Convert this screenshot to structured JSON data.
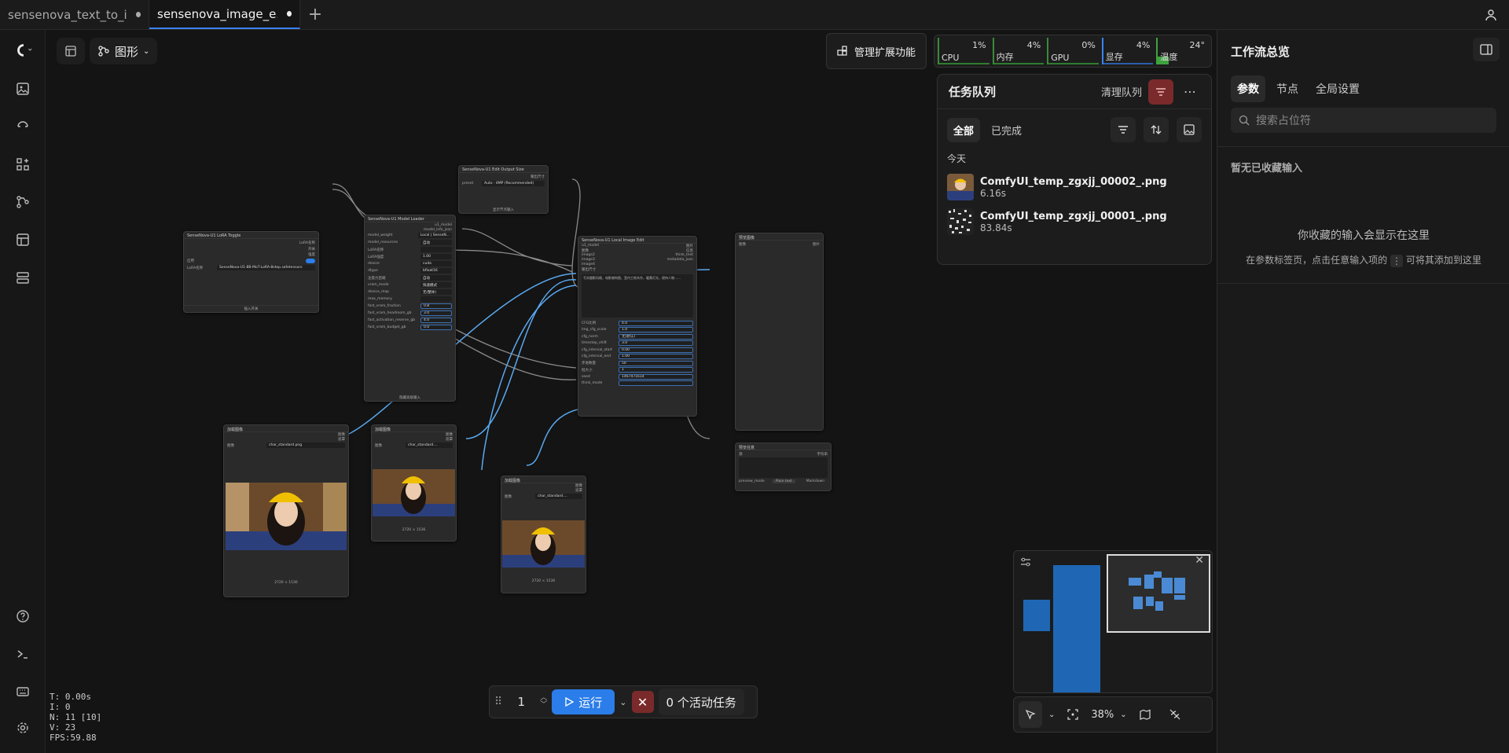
{
  "tabs": [
    {
      "label": "sensenova_text_to_i...",
      "active": false
    },
    {
      "label": "sensenova_image_e...",
      "active": true
    }
  ],
  "toolbar": {
    "graph_label": "图形",
    "manage_extensions": "管理扩展功能"
  },
  "stats": [
    {
      "label": "CPU",
      "value": "1%",
      "fraction": 0.01
    },
    {
      "label": "内存",
      "value": "4%",
      "fraction": 0.04
    },
    {
      "label": "GPU",
      "value": "0%",
      "fraction": 0.0
    },
    {
      "label": "显存",
      "value": "4%",
      "fraction": 0.04
    },
    {
      "label": "温度",
      "value": "24°",
      "fraction": 0.24
    }
  ],
  "queue": {
    "title": "任务队列",
    "clear_label": "清理队列",
    "filter_all": "全部",
    "filter_done": "已完成",
    "section_today": "今天",
    "items": [
      {
        "name": "ComfyUI_temp_zgxjj_00002_.png",
        "time": "6.16s"
      },
      {
        "name": "ComfyUI_temp_zgxjj_00001_.png",
        "time": "83.84s"
      }
    ]
  },
  "run": {
    "count": "1",
    "run_label": "运行",
    "active_tasks": "0 个活动任务"
  },
  "zoom": "38%",
  "fps": {
    "t": "T: 0.00s",
    "i": "I: 0",
    "n": "N: 11 [10]",
    "v": "V: 23",
    "fps": "FPS:59.88"
  },
  "right_panel": {
    "title": "工作流总览",
    "tabs": [
      "参数",
      "节点",
      "全局设置"
    ],
    "search_placeholder": "搜索占位符",
    "no_favorites": "暂无已收藏输入",
    "empty_title": "你收藏的输入会显示在这里",
    "empty_sub_a": "在参数标签页，点击任意输入项的",
    "empty_sub_b": "可将其添加到这里"
  },
  "nodes": {
    "lora_toggle": {
      "title": "SenseNova-U1 LoRA Toggle",
      "outputs": [
        "LoRA名称",
        "开关",
        "强度"
      ],
      "enable_label": "启用",
      "lora_label": "LoRA名称",
      "lora_value": "SenseNova-U1-8B-MoT-LoRA-8step.safetensors",
      "footer": "插入开关"
    },
    "output_size": {
      "title": "SenseNova-U1 Edit Output Size",
      "out": "输出尺寸",
      "preset_label": "preset",
      "preset_value": "Auto - 4MP (Recommended)",
      "footer": "显示节点输入"
    },
    "model_loader": {
      "title": "SenseNova-U1 Model Loader",
      "outputs": [
        "u1_model",
        "model_info_json"
      ],
      "rows": [
        {
          "label": "model_weight",
          "value": "Local | SenseN..."
        },
        {
          "label": "model_resources",
          "value": "自动"
        },
        {
          "label": "LoRA名称",
          "value": ""
        },
        {
          "label": "LoRA强度",
          "value": "1.00"
        },
        {
          "label": "device",
          "value": "cuda"
        },
        {
          "label": "dtype",
          "value": "bfloat16"
        },
        {
          "label": "注意力后端",
          "value": "自动"
        },
        {
          "label": "vram_mode",
          "value": "快速模式"
        },
        {
          "label": "device_map",
          "value": "无(整体)"
        },
        {
          "label": "max_memory",
          "value": ""
        },
        {
          "label": "fast_vram_fraction",
          "value": "0.8"
        },
        {
          "label": "fast_vram_headroom_gb",
          "value": "3.0"
        },
        {
          "label": "fast_activation_reserve_gb",
          "value": "4.0"
        },
        {
          "label": "fast_vram_budget_gb",
          "value": "0.0"
        }
      ],
      "footer": "隐藏高级输入"
    },
    "image_edit": {
      "title": "SenseNova-U1 Local Image Edit",
      "inputs": [
        "u1_model",
        "图像",
        "image2",
        "image3",
        "image4",
        "输出尺寸"
      ],
      "outputs": [
        "图片",
        "信息",
        "think_text",
        "metadata_json"
      ],
      "prompt": "写实摄影风格，电影感构图，室内工地木作，暖黄灯光，保持人物……",
      "rows": [
        {
          "label": "CFG比例",
          "value": "4.0"
        },
        {
          "label": "img_cfg_scale",
          "value": "1.0"
        },
        {
          "label": "cfg_norm",
          "value": "无(默认)"
        },
        {
          "label": "timestep_shift",
          "value": "3.0"
        },
        {
          "label": "cfg_interval_start",
          "value": "0.00"
        },
        {
          "label": "cfg_interval_end",
          "value": "1.00"
        },
        {
          "label": "步进数量",
          "value": "50"
        },
        {
          "label": "批大小",
          "value": "1"
        },
        {
          "label": "seed",
          "value": "1467471614"
        },
        {
          "label": "think_mode",
          "value": ""
        }
      ]
    },
    "preview": {
      "title": "预览图像",
      "in": "图像",
      "out": "图片"
    },
    "preview_text": {
      "title": "预览任意",
      "in": "源",
      "out": "字符串",
      "mode_label": "preview_mode",
      "plain": "Plain text",
      "markdown": "Markdown"
    },
    "load1": {
      "title": "加载图像",
      "file": "char_standard.png",
      "outputs": [
        "图像",
        "遮罩"
      ],
      "size": "2720 × 1536"
    },
    "load2": {
      "title": "加载图像",
      "file": "char_standard....",
      "outputs": [
        "图像",
        "遮罩"
      ],
      "size": "2720 × 1536"
    },
    "load3": {
      "title": "加载图像",
      "file": "char_standard....",
      "outputs": [
        "图像",
        "遮罩"
      ],
      "size": "2720 × 1536"
    }
  }
}
